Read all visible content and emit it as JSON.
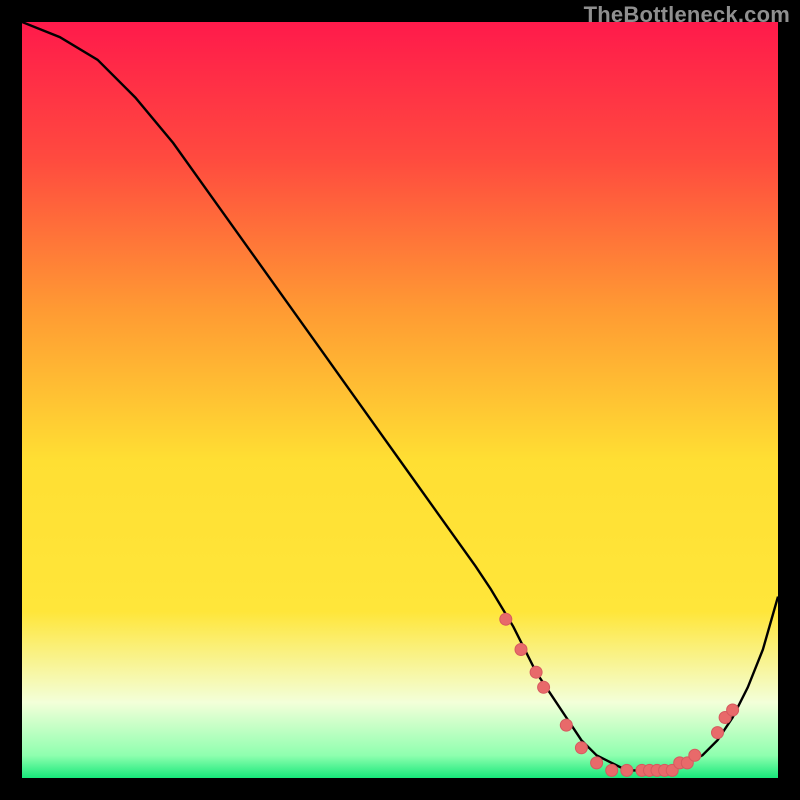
{
  "watermark": "TheBottleneck.com",
  "colors": {
    "bg_black": "#000000",
    "grad_top": "#ff1a4b",
    "grad_mid_yellow": "#ffe63a",
    "grad_pale": "#f3ffd9",
    "grad_green": "#17e87a",
    "curve": "#000000",
    "marker_fill": "#e86a6a",
    "marker_edge": "#d6595f"
  },
  "chart_data": {
    "type": "line",
    "title": "",
    "xlabel": "",
    "ylabel": "",
    "xlim": [
      0,
      100
    ],
    "ylim": [
      0,
      100
    ],
    "grid": false,
    "legend": false,
    "series": [
      {
        "name": "bottleneck-curve",
        "x": [
          0,
          5,
          10,
          15,
          20,
          25,
          30,
          35,
          40,
          45,
          50,
          55,
          60,
          62,
          65,
          68,
          70,
          72,
          74,
          76,
          78,
          80,
          82,
          84,
          86,
          88,
          90,
          92,
          94,
          96,
          98,
          100
        ],
        "y": [
          100,
          98,
          95,
          90,
          84,
          77,
          70,
          63,
          56,
          49,
          42,
          35,
          28,
          25,
          20,
          14,
          11,
          8,
          5,
          3,
          2,
          1,
          1,
          1,
          1,
          2,
          3,
          5,
          8,
          12,
          17,
          24
        ]
      }
    ],
    "markers": [
      {
        "x": 64,
        "y": 21
      },
      {
        "x": 66,
        "y": 17
      },
      {
        "x": 68,
        "y": 14
      },
      {
        "x": 69,
        "y": 12
      },
      {
        "x": 72,
        "y": 7
      },
      {
        "x": 74,
        "y": 4
      },
      {
        "x": 76,
        "y": 2
      },
      {
        "x": 78,
        "y": 1
      },
      {
        "x": 80,
        "y": 1
      },
      {
        "x": 82,
        "y": 1
      },
      {
        "x": 83,
        "y": 1
      },
      {
        "x": 84,
        "y": 1
      },
      {
        "x": 85,
        "y": 1
      },
      {
        "x": 86,
        "y": 1
      },
      {
        "x": 87,
        "y": 2
      },
      {
        "x": 88,
        "y": 2
      },
      {
        "x": 89,
        "y": 3
      },
      {
        "x": 92,
        "y": 6
      },
      {
        "x": 93,
        "y": 8
      },
      {
        "x": 94,
        "y": 9
      }
    ]
  }
}
